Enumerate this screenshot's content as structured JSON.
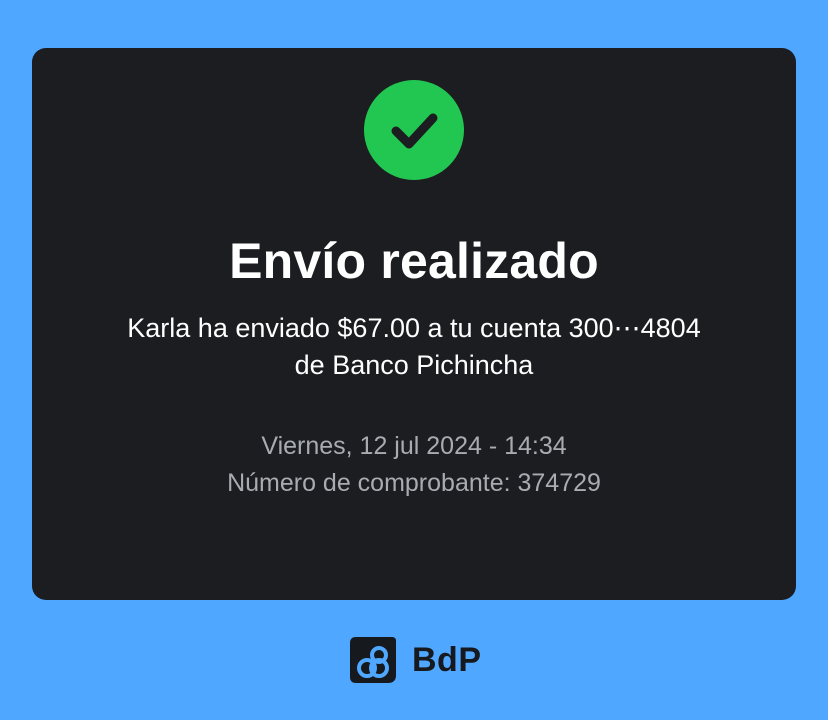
{
  "notification": {
    "title": "Envío realizado",
    "message_line1": "Karla ha enviado $67.00 a tu cuenta 300⋯4804",
    "message_line2": "de Banco Pichincha",
    "date_time": "Viernes, 12 jul 2024 - 14:34",
    "receipt": "Número de comprobante: 374729",
    "status_icon": "checkmark-icon"
  },
  "brand": {
    "name": "BdP",
    "logo_icon": "bdp-logo-icon"
  },
  "colors": {
    "background": "#4fa7ff",
    "card": "#1b1d20",
    "success": "#22c752",
    "muted_text": "#a8acb1"
  }
}
